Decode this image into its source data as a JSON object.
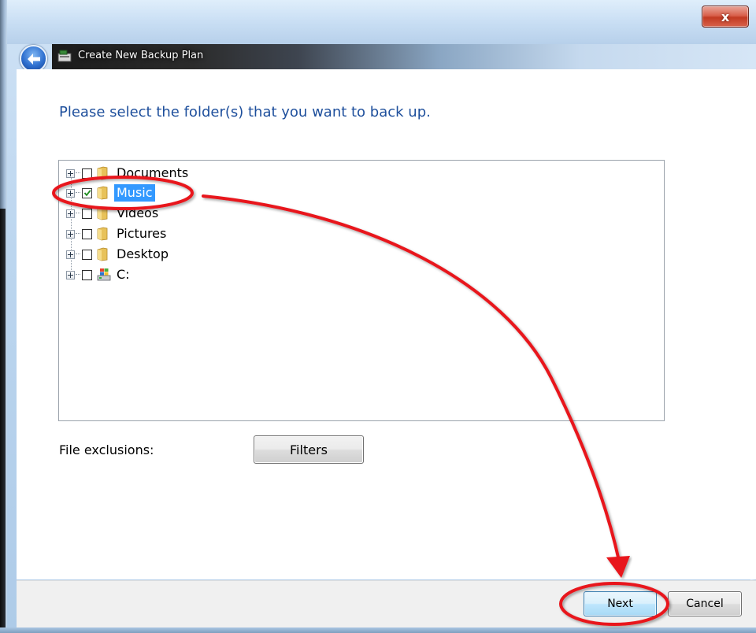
{
  "window": {
    "title": "Create New Backup Plan",
    "close_label": "x"
  },
  "main": {
    "heading": "Please select the folder(s) that you want to back up.",
    "tree": [
      {
        "label": "Documents",
        "checked": false,
        "selected": false,
        "icon": "folder-icon"
      },
      {
        "label": "Music",
        "checked": true,
        "selected": true,
        "icon": "folder-icon"
      },
      {
        "label": "Videos",
        "checked": false,
        "selected": false,
        "icon": "folder-icon"
      },
      {
        "label": "Pictures",
        "checked": false,
        "selected": false,
        "icon": "folder-icon"
      },
      {
        "label": "Desktop",
        "checked": false,
        "selected": false,
        "icon": "folder-icon"
      },
      {
        "label": "C:",
        "checked": false,
        "selected": false,
        "icon": "drive-icon"
      }
    ],
    "exclusions_label": "File exclusions:",
    "filters_label": "Filters"
  },
  "footer": {
    "next_label": "Next",
    "cancel_label": "Cancel"
  },
  "colors": {
    "heading": "#1e4f9c",
    "selection": "#3399ff",
    "annotation": "#e8141b"
  }
}
